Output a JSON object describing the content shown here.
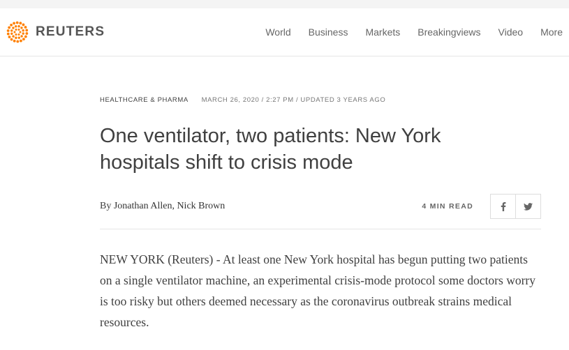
{
  "site": {
    "brand": "REUTERS",
    "accent_color": "#ff8000",
    "nav": [
      "World",
      "Business",
      "Markets",
      "Breakingviews",
      "Video",
      "More"
    ]
  },
  "article": {
    "section": "HEALTHCARE & PHARMA",
    "dateline": "MARCH 26, 2020 / 2:27 PM / UPDATED 3 YEARS AGO",
    "title": "One ventilator, two patients: New York hospitals shift to crisis mode",
    "byline_prefix": "By",
    "authors": "Jonathan Allen, Nick Brown",
    "read_time": "4 MIN READ",
    "share_icons": [
      "facebook-icon",
      "twitter-icon"
    ],
    "lead_paragraph": "NEW YORK (Reuters) - At least one New York hospital has begun putting two patients on a single ventilator machine, an experimental crisis-mode protocol some doctors worry is too risky but others deemed necessary as the coronavirus outbreak strains medical resources."
  }
}
